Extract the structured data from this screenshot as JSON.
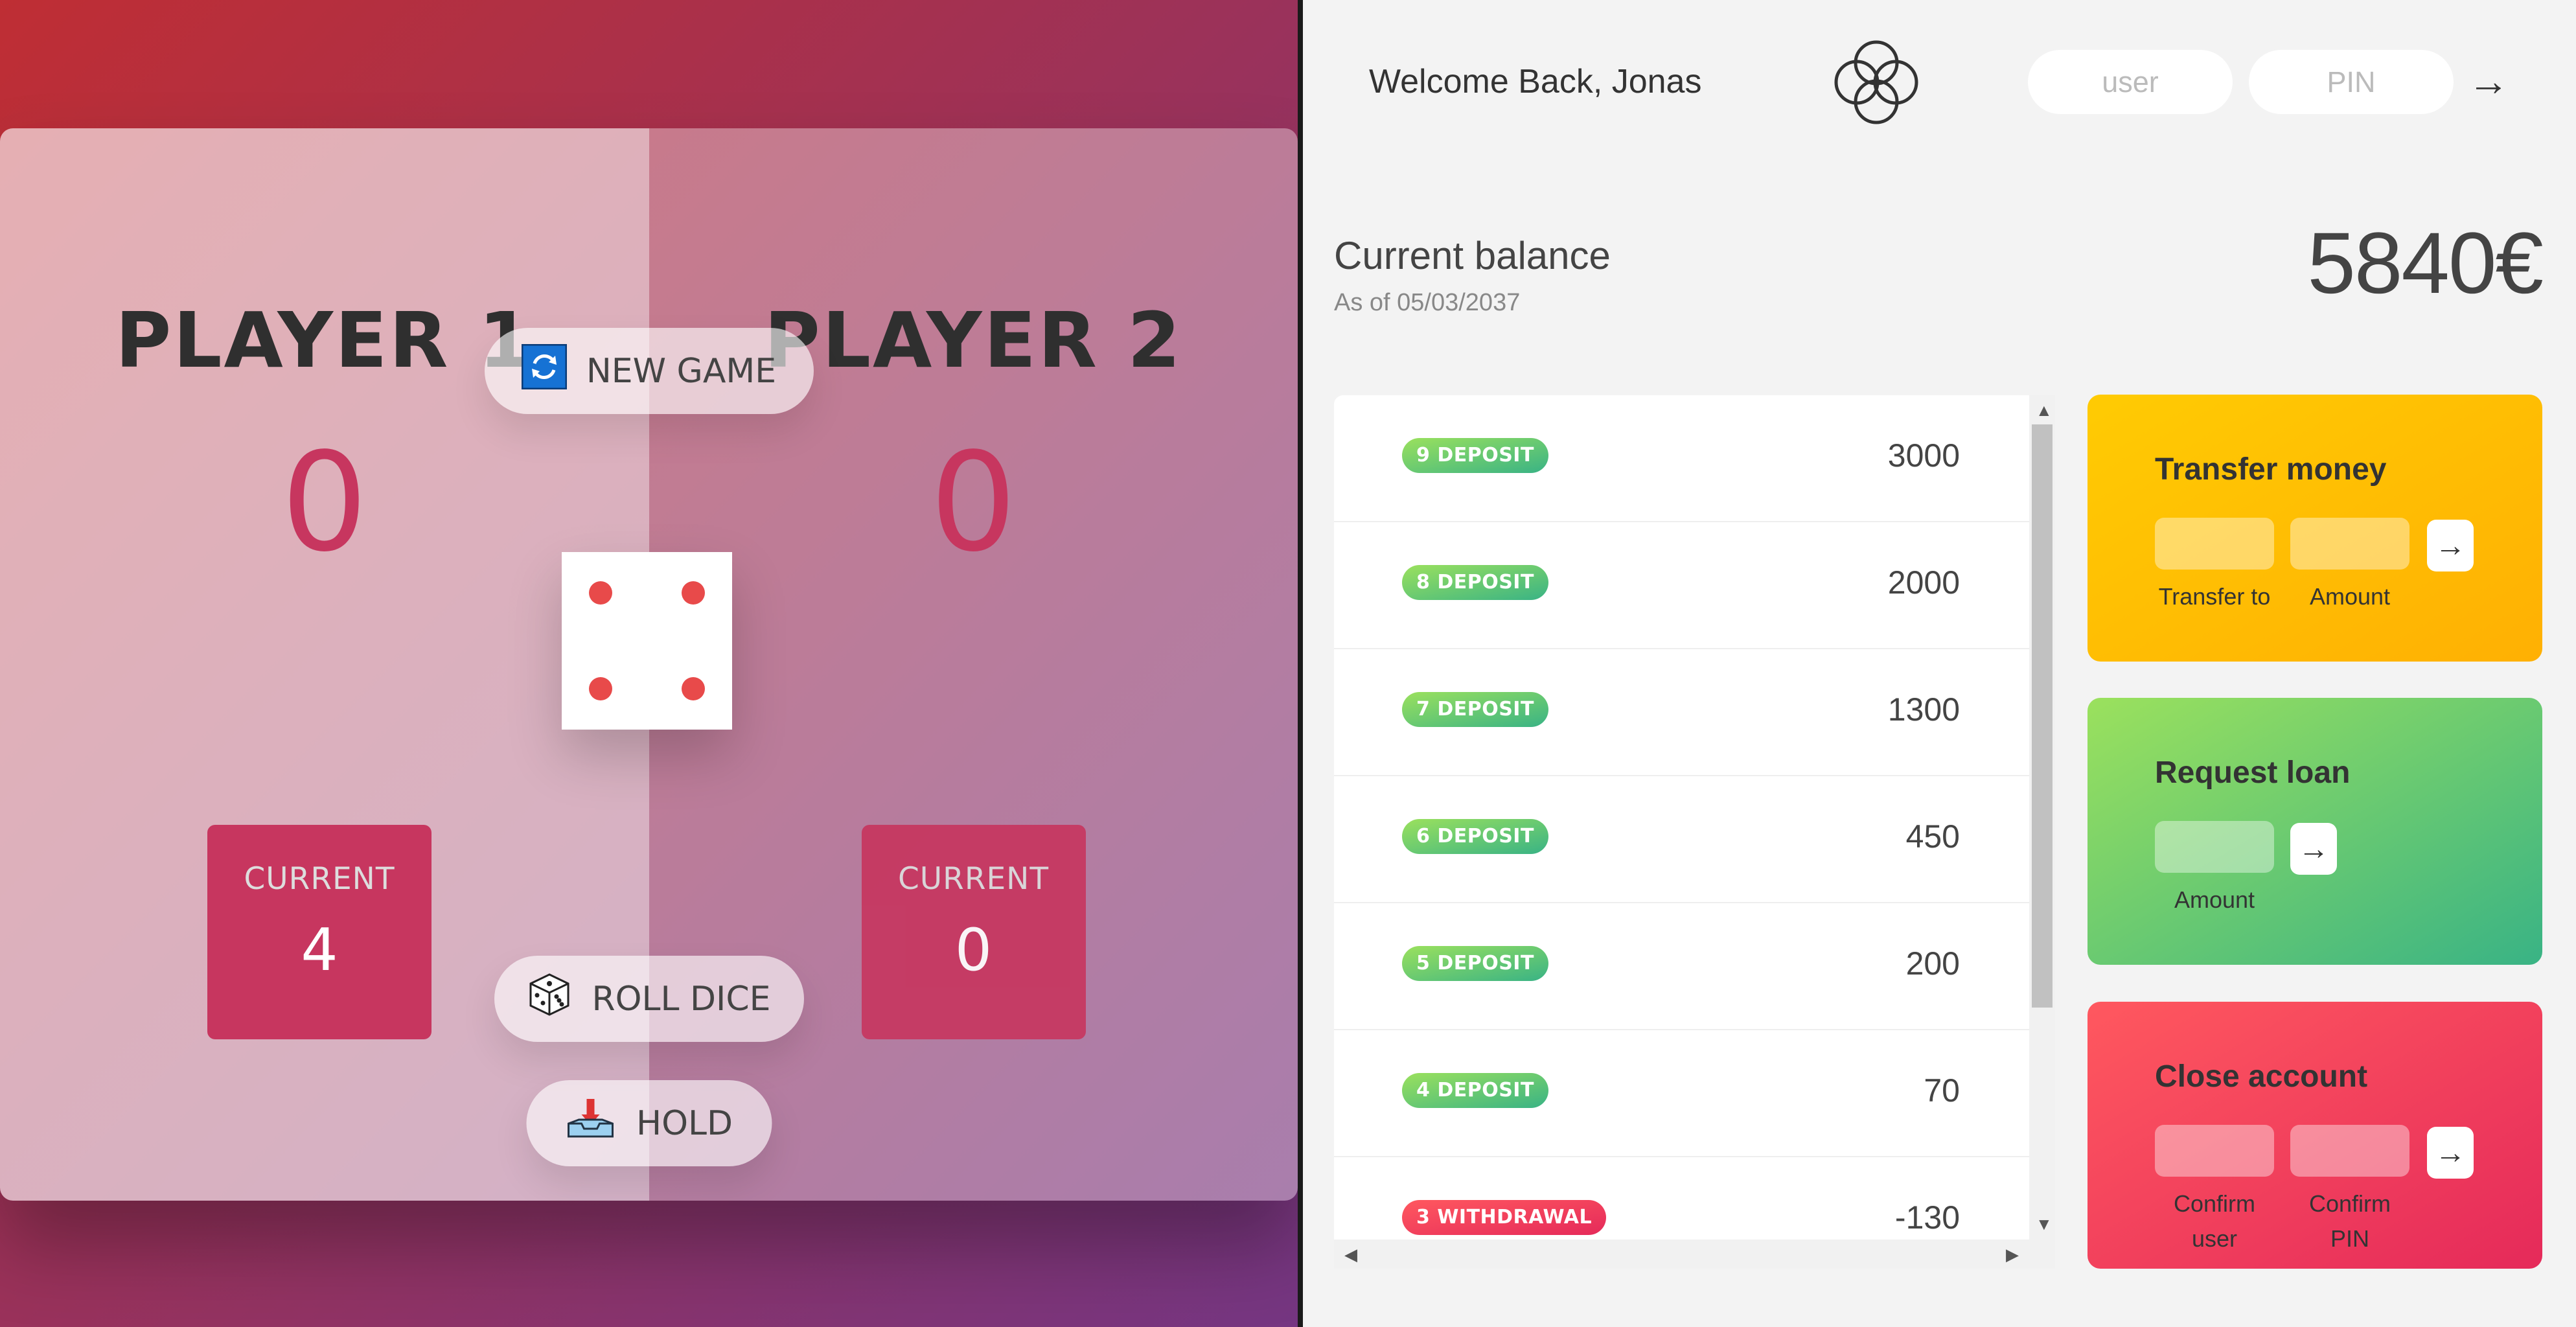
{
  "game": {
    "new_game_label": "NEW GAME",
    "roll_dice_label": "ROLL DICE",
    "hold_label": "HOLD",
    "dice_value": 4,
    "players": [
      {
        "name": "PLAYER 1",
        "score": "0",
        "current_label": "CURRENT",
        "current_score": "4"
      },
      {
        "name": "PLAYER 2",
        "score": "0",
        "current_label": "CURRENT",
        "current_score": "0"
      }
    ],
    "colors": {
      "accent": "#c7365f",
      "pip": "#e84a4a"
    }
  },
  "bank": {
    "welcome": "Welcome Back, Jonas",
    "login": {
      "user_placeholder": "user",
      "pin_placeholder": "PIN",
      "submit": "→"
    },
    "balance": {
      "label": "Current balance",
      "date": "As of 05/03/2037",
      "value": "5840€"
    },
    "movements": [
      {
        "type": "9 DEPOSIT",
        "kind": "deposit",
        "value": "3000"
      },
      {
        "type": "8 DEPOSIT",
        "kind": "deposit",
        "value": "2000"
      },
      {
        "type": "7 DEPOSIT",
        "kind": "deposit",
        "value": "1300"
      },
      {
        "type": "6 DEPOSIT",
        "kind": "deposit",
        "value": "450"
      },
      {
        "type": "5 DEPOSIT",
        "kind": "deposit",
        "value": "200"
      },
      {
        "type": "4 DEPOSIT",
        "kind": "deposit",
        "value": "70"
      },
      {
        "type": "3 WITHDRAWAL",
        "kind": "withdrawal",
        "value": "-130"
      }
    ],
    "transfer": {
      "title": "Transfer money",
      "to_label": "Transfer to",
      "amount_label": "Amount",
      "submit": "→"
    },
    "loan": {
      "title": "Request loan",
      "amount_label": "Amount",
      "submit": "→"
    },
    "close": {
      "title": "Close account",
      "user_label": "Confirm user",
      "pin_label": "Confirm PIN",
      "submit": "→"
    },
    "colors": {
      "transfer": "#ffb003",
      "loan": "#39b385",
      "close": "#e52a5a"
    }
  }
}
